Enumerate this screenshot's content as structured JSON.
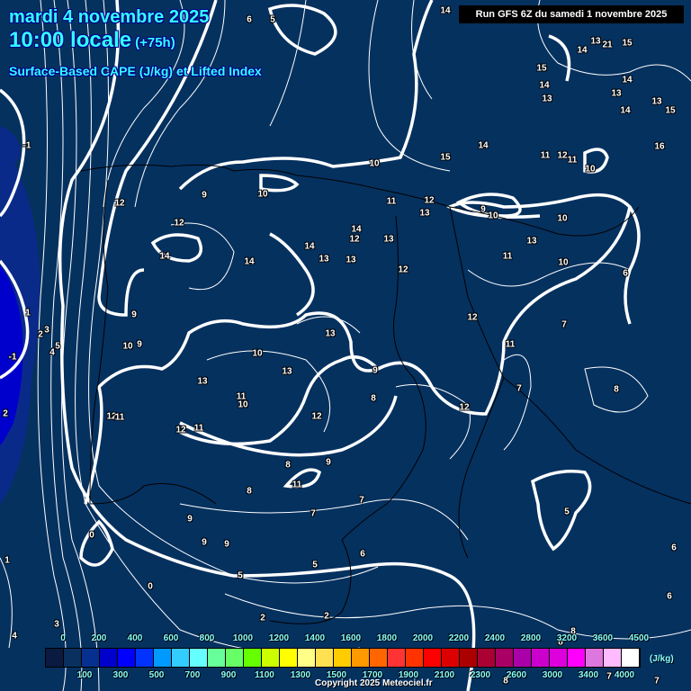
{
  "header": {
    "date": "mardi 4 novembre 2025",
    "time": "10:00 locale",
    "lead": "(+75h)",
    "parameter": "Surface-Based CAPE (J/kg) et Lifted Index",
    "run": "Run GFS 6Z du samedi 1 novembre 2025"
  },
  "colors": {
    "background": "#05315f",
    "contour": "#ffffff",
    "border": "#000000",
    "title": "#33ffff"
  },
  "colorbar": {
    "unit": "(J/kg)",
    "colors": [
      "#0a1a40",
      "#0a3060",
      "#06308f",
      "#0000cc",
      "#0000ff",
      "#0033ff",
      "#0099ff",
      "#33ccff",
      "#66ffff",
      "#66ff99",
      "#66ff66",
      "#66ff00",
      "#ccff00",
      "#ffff00",
      "#ffff88",
      "#ffe050",
      "#ffcc00",
      "#ff9900",
      "#ff6600",
      "#ff3333",
      "#ff3300",
      "#ff0000",
      "#dd0000",
      "#aa0000",
      "#aa0033",
      "#aa0066",
      "#aa00aa",
      "#cc00cc",
      "#dd00dd",
      "#ff00ff",
      "#dd77dd",
      "#ffbbff",
      "#ffffff"
    ],
    "top_labels": [
      "0",
      "200",
      "400",
      "600",
      "800",
      "1000",
      "1200",
      "1400",
      "1600",
      "1800",
      "2000",
      "2200",
      "2400",
      "2800",
      "3200",
      "3600",
      "4500"
    ],
    "bottom_labels": [
      "100",
      "300",
      "500",
      "700",
      "900",
      "1100",
      "1300",
      "1500",
      "1700",
      "1900",
      "2100",
      "2300",
      "2600",
      "3000",
      "3400",
      "4000"
    ]
  },
  "contour_labels": [
    "14",
    "6",
    "5",
    "15",
    "14",
    "13",
    "21",
    "15",
    "14",
    "13",
    "13",
    "14",
    "14",
    "13",
    "15",
    "16",
    "14",
    "15",
    "11",
    "12",
    "11",
    "10",
    "10",
    "9",
    "10",
    "11",
    "12",
    "13",
    "9",
    "10",
    "10",
    "12",
    "12",
    "14",
    "12",
    "13",
    "13",
    "14",
    "13",
    "11",
    "10",
    "13",
    "14",
    "14",
    "12",
    "6",
    "-1",
    "1",
    "2",
    "3",
    "4",
    "5",
    "-1",
    "2",
    "9",
    "10",
    "9",
    "12",
    "7",
    "13",
    "11",
    "10",
    "13",
    "9",
    "7",
    "8",
    "13",
    "11",
    "10",
    "8",
    "12",
    "12",
    "11",
    "12",
    "11",
    "12",
    "8",
    "9",
    "11",
    "8",
    "7",
    "7",
    "9",
    "5",
    "0",
    "9",
    "9",
    "6",
    "5",
    "5",
    "6",
    "1",
    "0",
    "6",
    "2",
    "2",
    "3",
    "4",
    "7",
    "8",
    "7",
    "8",
    "8"
  ],
  "copyright": "Copyright 2025 Meteociel.fr"
}
